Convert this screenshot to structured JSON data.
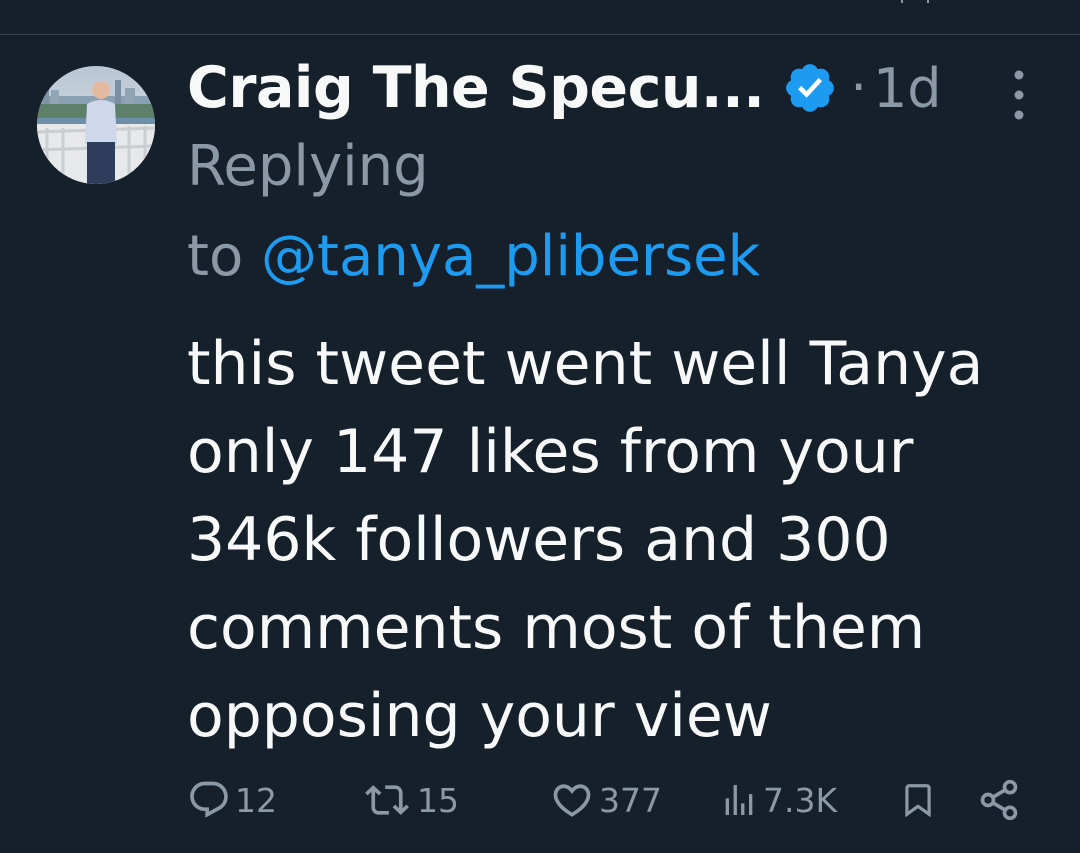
{
  "tweet": {
    "display_name": "Craig The Specu...",
    "separator": "·",
    "time": "1d",
    "replying_prefix": "Replying",
    "replying_to_word": "to",
    "replying_handle": "@tanya_plibersek",
    "body_lines": [
      "this tweet went well Tanya",
      "only 147 likes from your",
      "346k followers and 300",
      "comments most of them",
      "opposing your view"
    ]
  },
  "actions": {
    "replies": "12",
    "reposts": "15",
    "likes": "377",
    "views": "7.3K"
  },
  "icons": {
    "verified": "verified-badge-icon",
    "more": "more-vertical-icon",
    "reply": "reply-icon",
    "repost": "repost-icon",
    "like": "heart-icon",
    "views": "views-icon",
    "bookmark": "bookmark-icon",
    "share": "share-icon"
  },
  "colors": {
    "background": "#15202b",
    "text": "#f7f9f9",
    "muted": "#8b98a5",
    "accent": "#1d9bf0"
  }
}
